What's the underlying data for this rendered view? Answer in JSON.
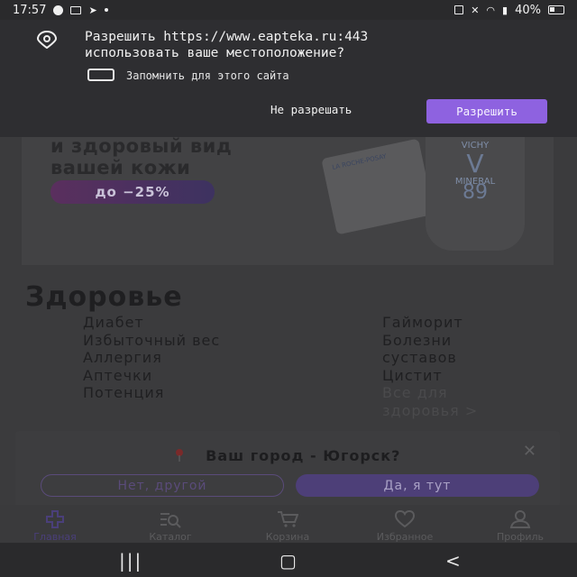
{
  "status_bar": {
    "time": "17:57",
    "battery": "40%"
  },
  "permission_dialog": {
    "message_line1": "Разрешить https://www.eapteka.ru:443",
    "message_line2": "использовать ваше местоположение?",
    "remember_label": "Запомнить для этого сайта",
    "deny_label": "Не разрешать",
    "allow_label": "Разрешить"
  },
  "banner": {
    "line1": "и здоровый вид",
    "line2": "вашей кожи",
    "promo": "до −25%",
    "product_brand": "VICHY",
    "product_name": "MINERAL",
    "product_number": "89",
    "tube_brand": "LA ROCHE-POSAY"
  },
  "health": {
    "title": "Здоровье",
    "left_items": [
      "Диабет",
      "Избыточный вес",
      "Аллергия",
      "Аптечки",
      "Потенция"
    ],
    "right_items": [
      "Гайморит",
      "Болезни суставов",
      "Цистит"
    ],
    "all_link": "Все для здоровья >"
  },
  "city_popup": {
    "question": "Ваш город - Югорск?",
    "no_label": "Нет, другой",
    "yes_label": "Да, я тут"
  },
  "bottom_nav": {
    "tabs": [
      {
        "label": "Главная",
        "icon": "plus-icon",
        "active": true
      },
      {
        "label": "Каталог",
        "icon": "catalog-search-icon"
      },
      {
        "label": "Корзина",
        "icon": "cart-icon"
      },
      {
        "label": "Избранное",
        "icon": "heart-icon"
      },
      {
        "label": "Профиль",
        "icon": "profile-icon"
      }
    ]
  },
  "colors": {
    "accent": "#8e62e0",
    "page_dim": "#3b3b3d"
  }
}
